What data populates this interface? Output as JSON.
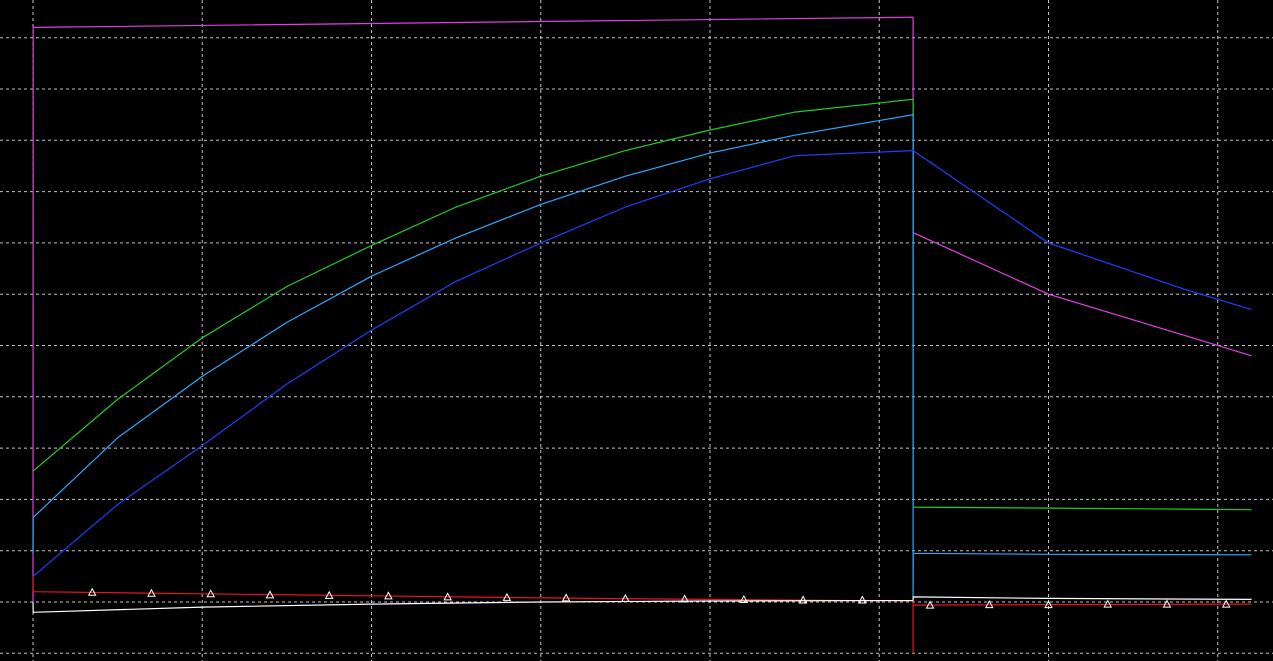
{
  "chart_data": {
    "type": "line",
    "title": "",
    "xlabel": "",
    "ylabel": "",
    "grid": true,
    "background": "#000000",
    "grid_color": "#e6e6e6",
    "xlim": [
      -0.2,
      7.3
    ],
    "ylim": [
      -0.5,
      11.5
    ],
    "series": [
      {
        "color": "#e040e0",
        "points": [
          [
            0,
            0
          ],
          [
            0.001,
            11.2
          ],
          [
            5.2,
            11.4
          ],
          [
            5.2,
            7.2
          ],
          [
            6.0,
            6.0
          ],
          [
            6.8,
            5.2
          ],
          [
            7.2,
            4.8
          ]
        ]
      },
      {
        "color": "#22cc22",
        "points": [
          [
            0,
            2.55
          ],
          [
            0.5,
            3.95
          ],
          [
            1.0,
            5.15
          ],
          [
            1.5,
            6.15
          ],
          [
            2.0,
            6.95
          ],
          [
            2.5,
            7.7
          ],
          [
            3.0,
            8.3
          ],
          [
            3.5,
            8.8
          ],
          [
            4.0,
            9.2
          ],
          [
            4.5,
            9.55
          ],
          [
            5.2,
            9.8
          ],
          [
            5.2,
            1.85
          ],
          [
            6.0,
            1.83
          ],
          [
            6.8,
            1.81
          ],
          [
            7.2,
            1.8
          ]
        ]
      },
      {
        "color": "#2aa8ff",
        "points": [
          [
            0,
            0.95
          ],
          [
            0.001,
            1.65
          ],
          [
            0.5,
            3.2
          ],
          [
            1.0,
            4.4
          ],
          [
            1.5,
            5.45
          ],
          [
            2.0,
            6.35
          ],
          [
            2.5,
            7.1
          ],
          [
            3.0,
            7.75
          ],
          [
            3.5,
            8.3
          ],
          [
            4.0,
            8.75
          ],
          [
            4.5,
            9.1
          ],
          [
            5.2,
            9.5
          ],
          [
            5.2,
            0.1
          ],
          [
            5.201,
            0.95
          ],
          [
            6.0,
            0.93
          ],
          [
            7.2,
            0.92
          ]
        ]
      },
      {
        "color": "#1f3fff",
        "points": [
          [
            0,
            0.5
          ],
          [
            0.5,
            1.9
          ],
          [
            1.0,
            3.05
          ],
          [
            1.5,
            4.25
          ],
          [
            2.0,
            5.3
          ],
          [
            2.5,
            6.25
          ],
          [
            3.0,
            7.0
          ],
          [
            3.5,
            7.7
          ],
          [
            4.0,
            8.25
          ],
          [
            4.5,
            8.7
          ],
          [
            5.2,
            8.8
          ],
          [
            6.0,
            7.0
          ],
          [
            6.8,
            6.1
          ],
          [
            7.2,
            5.7
          ]
        ]
      },
      {
        "color": "#e8141a",
        "points": [
          [
            0,
            0.5
          ],
          [
            0.001,
            0.2
          ],
          [
            1.0,
            0.16
          ],
          [
            2.0,
            0.12
          ],
          [
            3.0,
            0.08
          ],
          [
            4.0,
            0.05
          ],
          [
            5.2,
            0.02
          ],
          [
            5.2,
            -1.0
          ],
          [
            5.2,
            -0.06
          ],
          [
            6.0,
            -0.05
          ],
          [
            7.2,
            -0.04
          ]
        ]
      },
      {
        "color": "#ffffff",
        "marker": "triangle",
        "points": [
          [
            0,
            0
          ],
          [
            0.001,
            -0.2
          ],
          [
            1.0,
            -0.1
          ],
          [
            2.0,
            -0.04
          ],
          [
            3.0,
            0.0
          ],
          [
            4.0,
            0.02
          ],
          [
            5.2,
            0.03
          ],
          [
            5.2,
            0.1
          ],
          [
            6.0,
            0.07
          ],
          [
            7.2,
            0.05
          ]
        ],
        "marker_points": [
          [
            0.35,
            0.18
          ],
          [
            0.7,
            0.16
          ],
          [
            1.05,
            0.15
          ],
          [
            1.4,
            0.13
          ],
          [
            1.75,
            0.12
          ],
          [
            2.1,
            0.11
          ],
          [
            2.45,
            0.09
          ],
          [
            2.8,
            0.08
          ],
          [
            3.15,
            0.07
          ],
          [
            3.5,
            0.06
          ],
          [
            3.85,
            0.05
          ],
          [
            4.2,
            0.04
          ],
          [
            4.55,
            0.03
          ],
          [
            4.9,
            0.03
          ],
          [
            5.3,
            -0.07
          ],
          [
            5.65,
            -0.06
          ],
          [
            6.0,
            -0.06
          ],
          [
            6.35,
            -0.05
          ],
          [
            6.7,
            -0.05
          ],
          [
            7.05,
            -0.05
          ]
        ]
      }
    ]
  }
}
